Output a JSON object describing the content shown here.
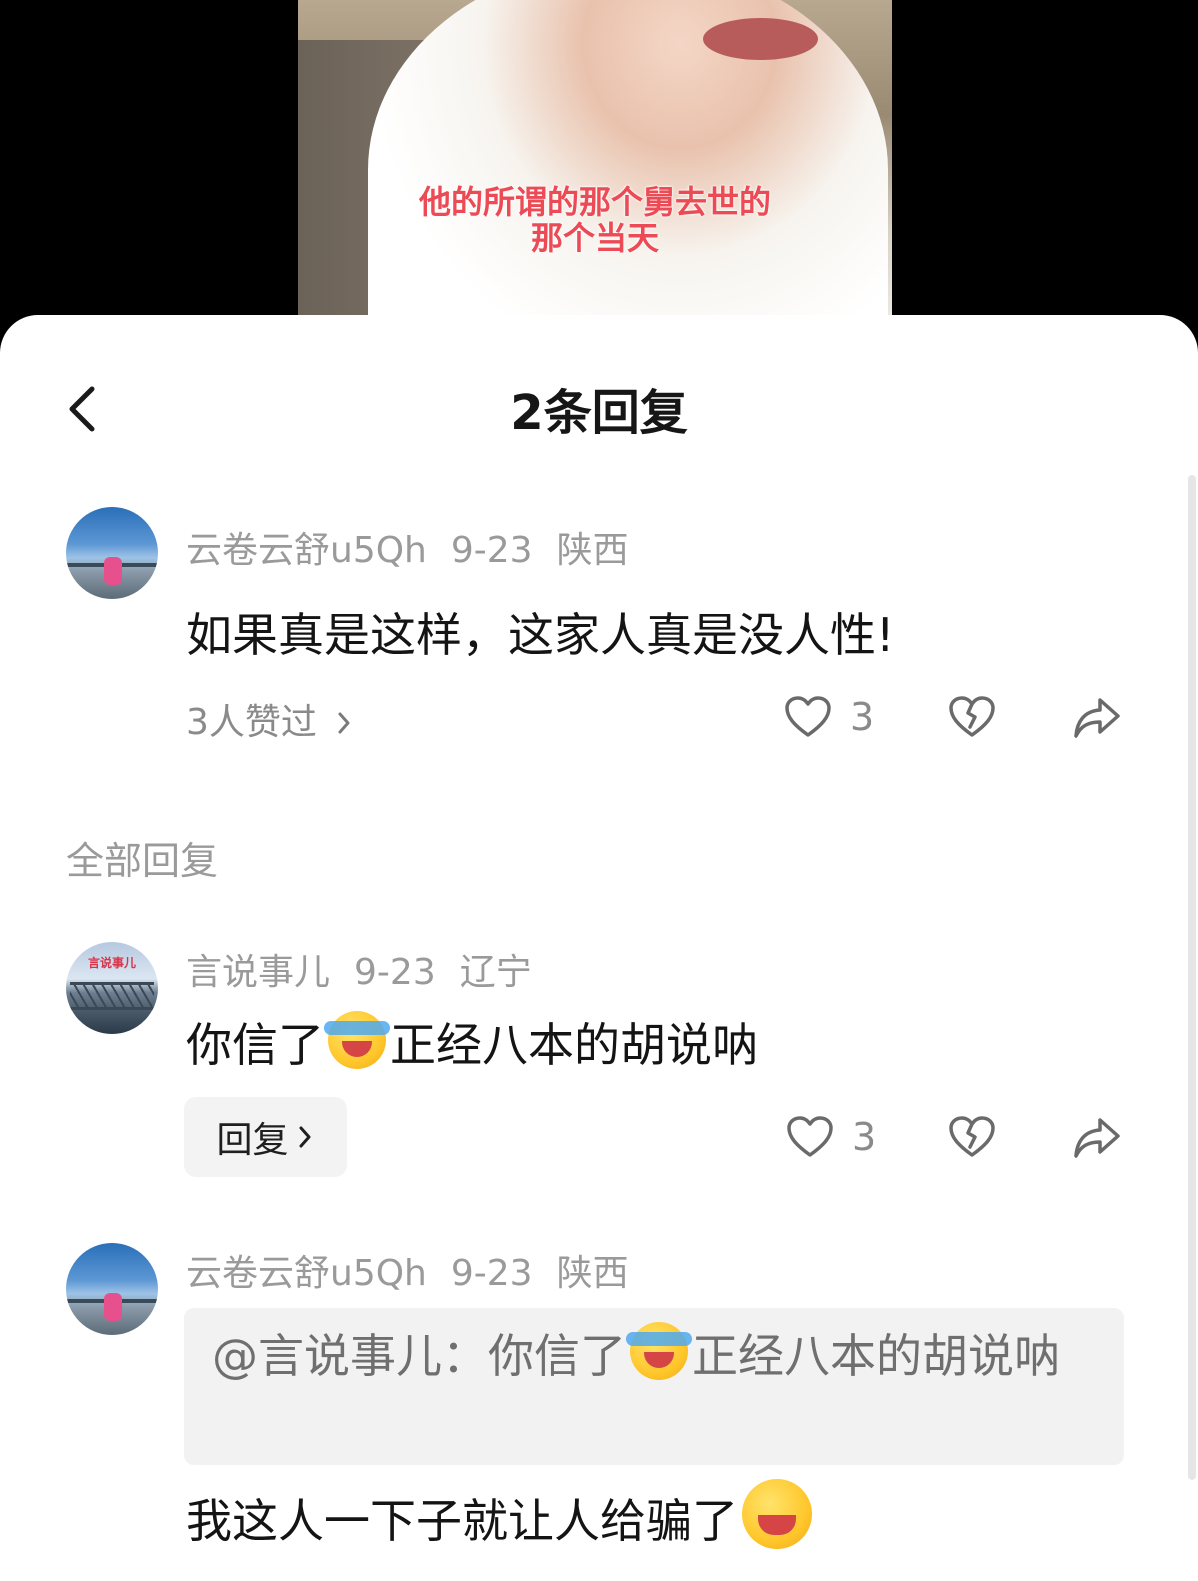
{
  "video": {
    "caption_line1": "他的所谓的那个舅去世的",
    "caption_line2": "那个当天"
  },
  "header": {
    "title": "2条回复"
  },
  "parent_comment": {
    "username": "云卷云舒u5Qh",
    "date": "9-23",
    "location": "陕西",
    "text": "如果真是这样，这家人真是没人性!",
    "likes_link": "3人赞过",
    "like_count": "3"
  },
  "section_label": "全部回复",
  "replies": [
    {
      "username": "言说事儿",
      "avatar_text": "言说事儿",
      "date": "9-23",
      "location": "辽宁",
      "text_before": "你信了",
      "emoji": "laughing-tears-emoji",
      "text_after": "正经八本的胡说呐",
      "reply_label": "回复",
      "like_count": "3"
    },
    {
      "username": "云卷云舒u5Qh",
      "date": "9-23",
      "location": "陕西",
      "quote_before": "@言说事儿：你信了",
      "quote_emoji": "laughing-tears-emoji",
      "quote_after": "正经八本的胡说呐",
      "text": "我这人一下子就让人给骗了",
      "text_emoji": "grinning-squint-emoji"
    }
  ],
  "colors": {
    "caption_red": "#ec4a55",
    "meta_gray": "#9a9a9a",
    "text_dark": "#141414",
    "quote_bg": "#f2f2f2"
  },
  "icons": {
    "back": "chevron-left-icon",
    "like": "heart-outline-icon",
    "dislike": "broken-heart-icon",
    "share": "share-arrow-icon",
    "more": "chevron-right-icon"
  }
}
